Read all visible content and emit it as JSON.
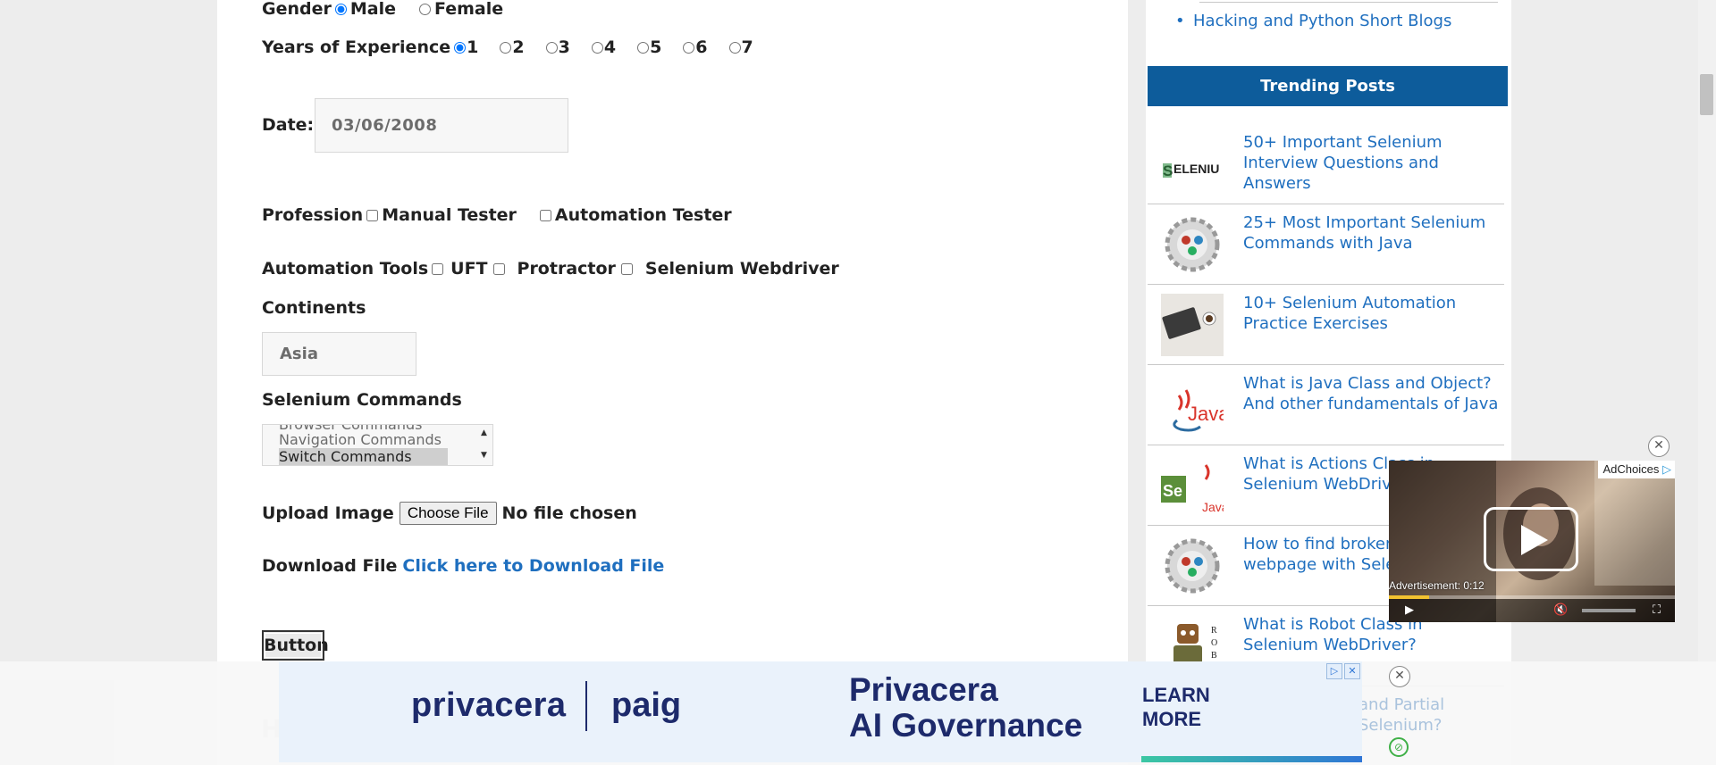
{
  "form": {
    "gender": {
      "label": "Gender",
      "options": [
        "Male",
        "Female"
      ],
      "selected": "Male"
    },
    "experience": {
      "label": "Years of Experience",
      "options": [
        "1",
        "2",
        "3",
        "4",
        "5",
        "6",
        "7"
      ],
      "selected": "1"
    },
    "date": {
      "label": "Date:",
      "value": "03/06/2008"
    },
    "profession": {
      "label": "Profession",
      "options": [
        "Manual Tester",
        "Automation Tester"
      ]
    },
    "tools": {
      "label": "Automation Tools",
      "options": [
        "UFT",
        "Protractor",
        "Selenium Webdriver"
      ]
    },
    "continents": {
      "label": "Continents",
      "value": "Asia"
    },
    "selenium_commands": {
      "label": "Selenium Commands",
      "items": [
        "Browser Commands",
        "Navigation Commands",
        "Switch Commands"
      ],
      "selected": "Switch Commands"
    },
    "upload": {
      "label": "Upload Image",
      "button": "Choose File",
      "status": "No file chosen"
    },
    "download": {
      "label": "Download File",
      "link": "Click here to Download File"
    },
    "button_label": "Button"
  },
  "sidebar": {
    "top_link": "Hacking and Python Short Blogs",
    "trending_heading": "Trending Posts",
    "posts": [
      {
        "title": "50+ Important Selenium Interview Questions and Answers",
        "thumb": "SELENIU"
      },
      {
        "title": "25+ Most Important Selenium Commands with Java",
        "thumb": ""
      },
      {
        "title": "10+ Selenium Automation Practice Exercises",
        "thumb": ""
      },
      {
        "title": "What is Java Class and Object? And other fundamentals of Java",
        "thumb": "Java"
      },
      {
        "title": "What is Actions Class in Selenium WebDriver?",
        "thumb": "Java"
      },
      {
        "title": "How to find broken links on a webpage with Selenium?",
        "thumb": ""
      },
      {
        "title": "What is Robot Class in Selenium WebDriver?",
        "thumb": "ROBO"
      }
    ]
  },
  "video_ad": {
    "adchoices": "AdChoices",
    "label": "Advertisement: 0:12",
    "progress": 0.14
  },
  "banner_ad": {
    "brand": "privacera",
    "product": "paig",
    "headline_1": "Privacera",
    "headline_2": "AI Governance",
    "cta_1": "LEARN",
    "cta_2": "MORE"
  },
  "colors": {
    "link": "#1f6fbf",
    "trending_bg": "#0d5c9b",
    "brand_navy": "#1d2a6b"
  }
}
